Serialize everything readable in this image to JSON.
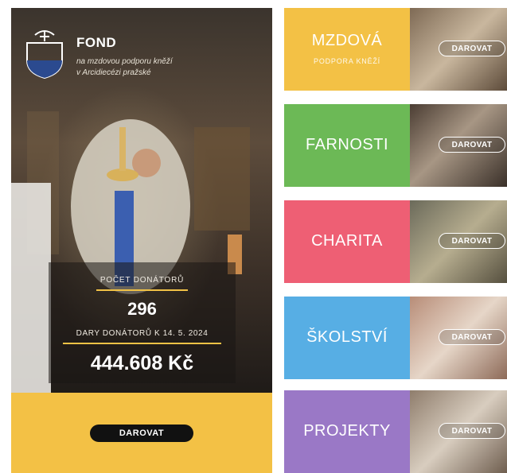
{
  "fund": {
    "title": "FOND",
    "subtitle_line1": "na mzdovou podporu kněží",
    "subtitle_line2": "v Arcidiecézi pražské"
  },
  "stats": {
    "donors_label": "POČET DONÁTORŮ",
    "donors_count": "296",
    "gifts_label": "DARY DONÁTORŮ K 14. 5. 2024",
    "gifts_amount": "444.608 Kč"
  },
  "main_button": "DAROVAT",
  "colors": {
    "yellow": "#f3c145",
    "green": "#6cb956",
    "red": "#ee5f74",
    "blue": "#57aee4",
    "purple": "#9a78c6"
  },
  "tiles": [
    {
      "title": "MZDOVÁ",
      "subtitle": "PODPORA KNĚŽÍ",
      "button": "DAROVAT"
    },
    {
      "title": "FARNOSTI",
      "button": "DAROVAT"
    },
    {
      "title": "CHARITA",
      "button": "DAROVAT"
    },
    {
      "title": "ŠKOLSTVÍ",
      "button": "DAROVAT"
    },
    {
      "title": "PROJEKTY",
      "button": "DAROVAT"
    }
  ]
}
